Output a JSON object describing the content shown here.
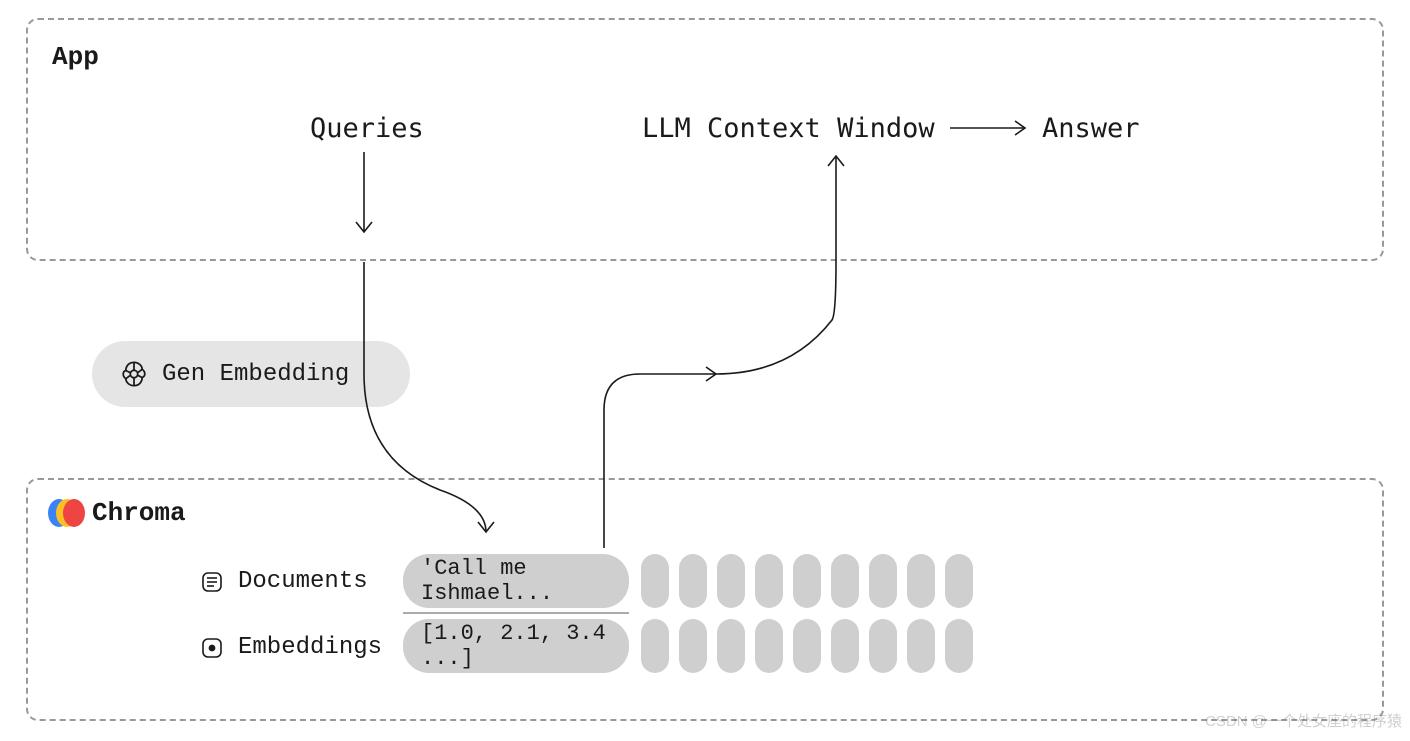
{
  "app": {
    "title": "App",
    "queries_label": "Queries",
    "llm_label": "LLM Context Window",
    "answer_label": "Answer"
  },
  "gen_embedding": {
    "label": "Gen Embedding"
  },
  "chroma": {
    "title": "Chroma",
    "documents_label": "Documents",
    "embeddings_label": "Embeddings",
    "doc_sample": "'Call me Ishmael...",
    "emb_sample": "[1.0, 2.1, 3.4 ...]"
  },
  "watermark": "CSDN @一个处女座的程序猿"
}
